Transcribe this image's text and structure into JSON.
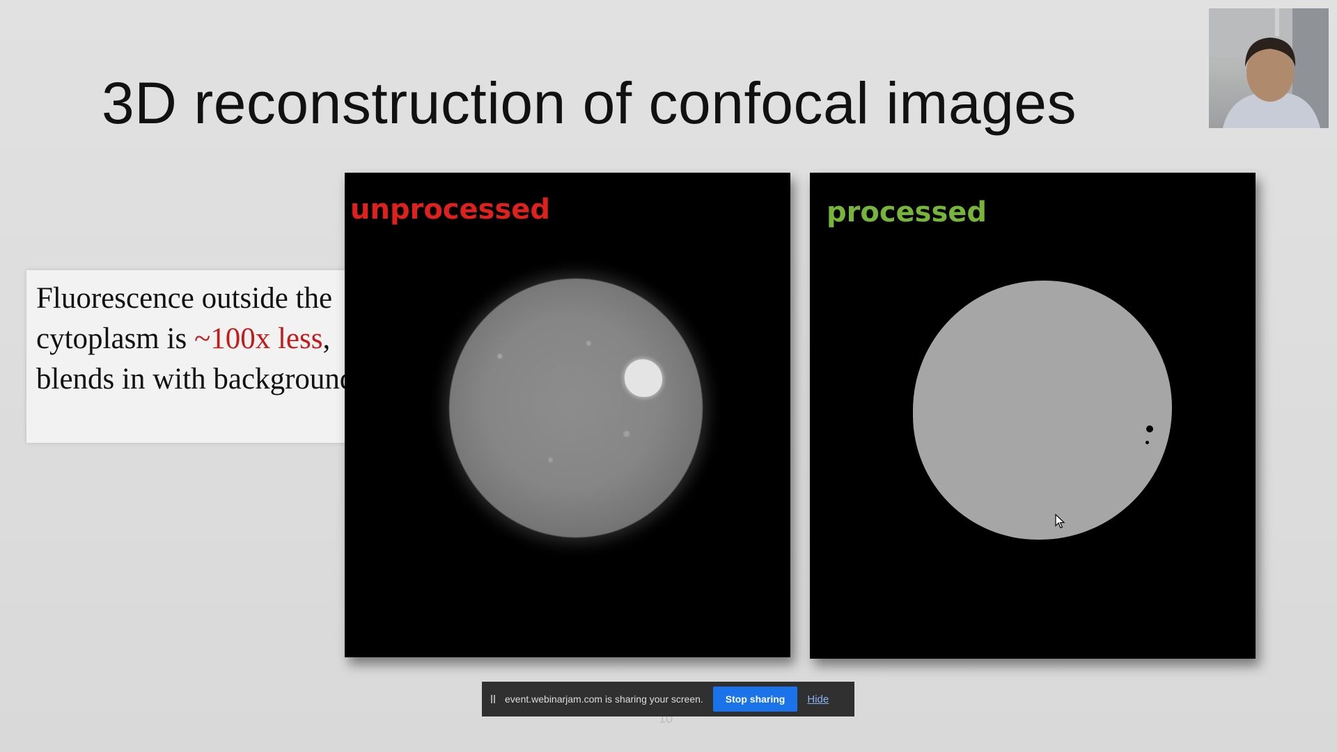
{
  "slide": {
    "title": "3D reconstruction of confocal images",
    "page_number": "10",
    "callout": {
      "text_before": "Fluorescence outside the cytoplasm is ",
      "highlight": "~100x less",
      "text_after": ", blends in with background",
      "highlight_color": "#c41a1a"
    },
    "panels": {
      "left_label": "unprocessed",
      "right_label": "processed",
      "left_label_color": "#e0201c",
      "right_label_color": "#77b53a"
    }
  },
  "share_bar": {
    "message": "event.webinarjam.com is sharing your screen.",
    "stop_label": "Stop sharing",
    "hide_label": "Hide"
  },
  "colors": {
    "share_button": "#1a73e8",
    "share_bar_bg": "#303030"
  }
}
